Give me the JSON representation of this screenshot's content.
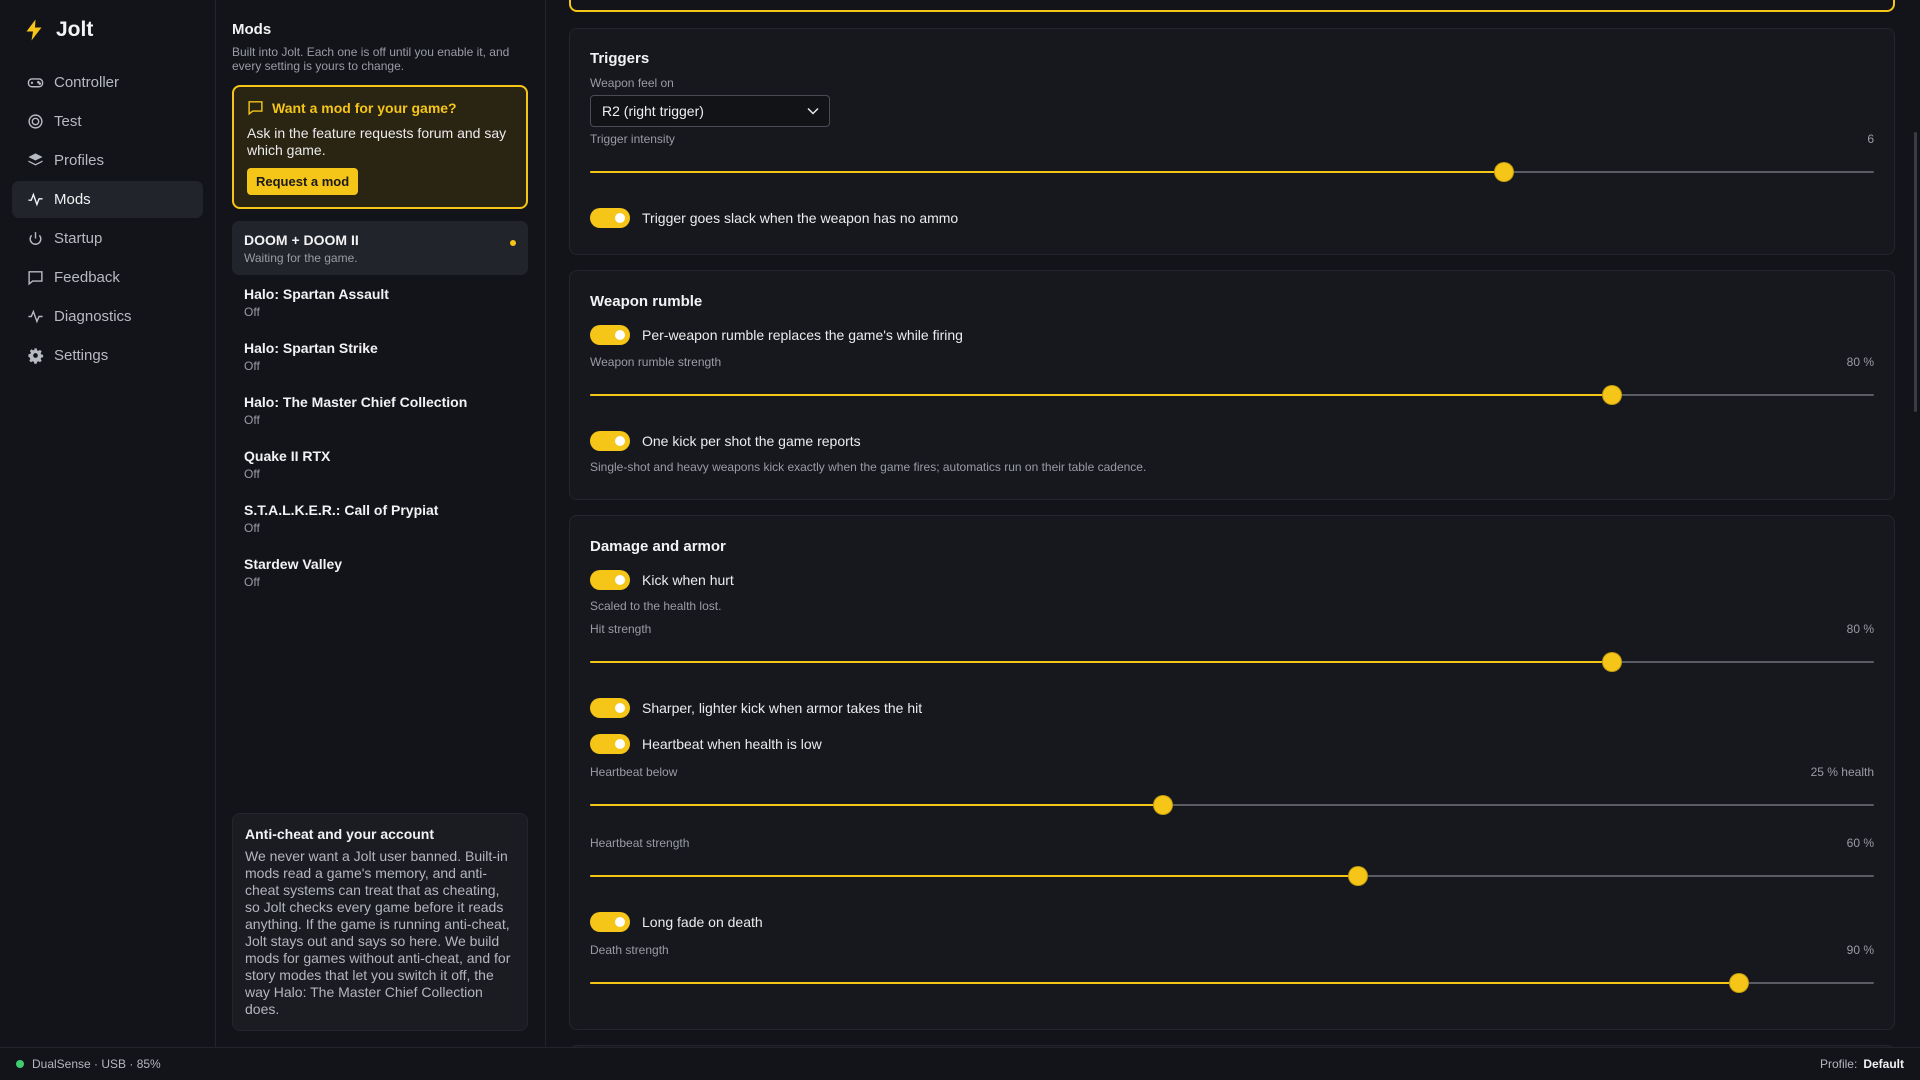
{
  "app": {
    "name": "Jolt"
  },
  "nav": [
    {
      "label": "Controller",
      "icon": "gamepad-icon"
    },
    {
      "label": "Test",
      "icon": "target-icon"
    },
    {
      "label": "Profiles",
      "icon": "layers-icon"
    },
    {
      "label": "Mods",
      "icon": "activity-icon",
      "active": true
    },
    {
      "label": "Startup",
      "icon": "power-icon"
    },
    {
      "label": "Feedback",
      "icon": "message-icon"
    },
    {
      "label": "Diagnostics",
      "icon": "pulse-icon"
    },
    {
      "label": "Settings",
      "icon": "gear-icon"
    }
  ],
  "mods_panel": {
    "title": "Mods",
    "subtitle": "Built into Jolt. Each one is off until you enable it, and every setting is yours to change.",
    "request": {
      "heading": "Want a mod for your game?",
      "body": "Ask in the feature requests forum and say which game.",
      "button": "Request a mod"
    },
    "mods": [
      {
        "name": "DOOM + DOOM II",
        "status": "Waiting for the game."
      },
      {
        "name": "Halo: Spartan Assault",
        "status": "Off"
      },
      {
        "name": "Halo: Spartan Strike",
        "status": "Off"
      },
      {
        "name": "Halo: The Master Chief Collection",
        "status": "Off"
      },
      {
        "name": "Quake II RTX",
        "status": "Off"
      },
      {
        "name": "S.T.A.L.K.E.R.: Call of Prypiat",
        "status": "Off"
      },
      {
        "name": "Stardew Valley",
        "status": "Off"
      }
    ],
    "anticheat": {
      "title": "Anti-cheat and your account",
      "body": "We never want a Jolt user banned. Built-in mods read a game's memory, and anti-cheat systems can treat that as cheating, so Jolt checks every game before it reads anything. If the game is running anti-cheat, Jolt stays out and says so here. We build mods for games without anti-cheat, and for story modes that let you switch it off, the way Halo: The Master Chief Collection does."
    }
  },
  "triggers": {
    "title": "Triggers",
    "weapon_feel_label": "Weapon feel on",
    "weapon_feel_value": "R2 (right trigger)",
    "intensity_label": "Trigger intensity",
    "intensity_value": "6",
    "intensity_fraction": 0.712,
    "slack_label": "Trigger goes slack when the weapon has no ammo"
  },
  "weapon_rumble": {
    "title": "Weapon rumble",
    "per_weapon_label": "Per-weapon rumble replaces the game's while firing",
    "strength_label": "Weapon rumble strength",
    "strength_value": "80 %",
    "strength_fraction": 0.796,
    "one_kick_label": "One kick per shot the game reports",
    "one_kick_note": "Single-shot and heavy weapons kick exactly when the game fires; automatics run on their table cadence."
  },
  "damage": {
    "title": "Damage and armor",
    "kick_label": "Kick when hurt",
    "kick_note": "Scaled to the health lost.",
    "hit_label": "Hit strength",
    "hit_value": "80 %",
    "hit_fraction": 0.796,
    "armor_label": "Sharper, lighter kick when armor takes the hit",
    "heartbeat_toggle_label": "Heartbeat when health is low",
    "heartbeat_below_label": "Heartbeat below",
    "heartbeat_below_value": "25 % health",
    "heartbeat_below_fraction": 0.446,
    "heartbeat_strength_label": "Heartbeat strength",
    "heartbeat_strength_value": "60 %",
    "heartbeat_strength_fraction": 0.598,
    "death_toggle_label": "Long fade on death",
    "death_label": "Death strength",
    "death_value": "90 %",
    "death_fraction": 0.895
  },
  "status": {
    "device": "DualSense · USB · 85%",
    "profile_label": "Profile:",
    "profile_value": "Default"
  },
  "colors": {
    "accent": "#f5c518",
    "connected": "#3fce6f",
    "background": "#131419"
  }
}
